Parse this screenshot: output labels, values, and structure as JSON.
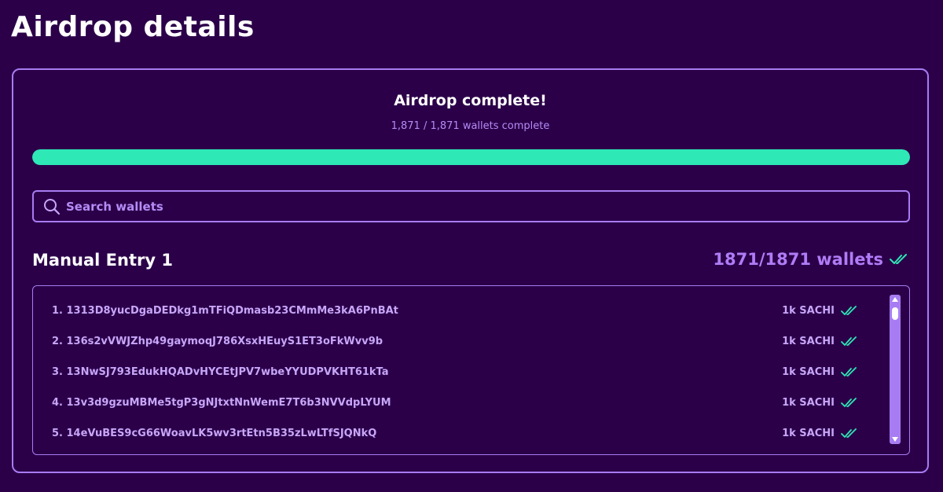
{
  "header": {
    "title": "Airdrop details"
  },
  "status": {
    "title": "Airdrop complete!",
    "subtitle": "1,871 / 1,871 wallets complete",
    "progress_fraction": 1.0,
    "progress_color": "#2ee8b6"
  },
  "search": {
    "placeholder": "Search wallets",
    "value": ""
  },
  "group": {
    "name": "Manual Entry 1",
    "count_label": "1871/1871 wallets",
    "count_icon": "double-check-icon"
  },
  "wallets": [
    {
      "label": "1. 1313D8yucDgaDEDkg1mTFiQDmasb23CMmMe3kA6PnBAt",
      "amount": "1k SACHI",
      "status_icon": "double-check-icon"
    },
    {
      "label": "2. 136s2vVWJZhp49gaymoqJ786XsxHEuyS1ET3oFkWvv9b",
      "amount": "1k SACHI",
      "status_icon": "double-check-icon"
    },
    {
      "label": "3. 13NwSJ793EdukHQADvHYCEtJPV7wbeYYUDPVKHT61kTa",
      "amount": "1k SACHI",
      "status_icon": "double-check-icon"
    },
    {
      "label": "4. 13v3d9gzuMBMe5tgP3gNJtxtNnWemE7T6b3NVVdpLYUM",
      "amount": "1k SACHI",
      "status_icon": "double-check-icon"
    },
    {
      "label": "5. 14eVuBES9cG66WoavLK5wv3rtEtn5B35zLwLTfSJQNkQ",
      "amount": "1k SACHI",
      "status_icon": "double-check-icon"
    }
  ],
  "colors": {
    "background": "#2b0049",
    "accent": "#a77cf2",
    "success": "#2ee8b6"
  }
}
